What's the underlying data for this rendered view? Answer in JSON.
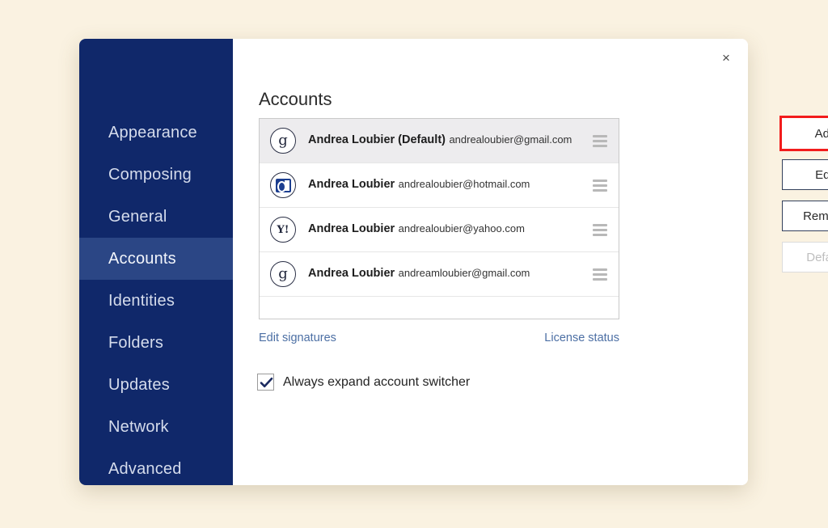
{
  "theme": {
    "page_background": "#FAF2E1",
    "sidebar_background": "#10286A",
    "sidebar_active_background": "#2B4685",
    "accent_highlight": "#F21C1C",
    "link_color": "#4C6FA4",
    "row_selected_background": "#EDECEE"
  },
  "dialog": {
    "close_label": "×"
  },
  "sidebar": {
    "items": [
      {
        "label": "Appearance",
        "active": false
      },
      {
        "label": "Composing",
        "active": false
      },
      {
        "label": "General",
        "active": false
      },
      {
        "label": "Accounts",
        "active": true
      },
      {
        "label": "Identities",
        "active": false
      },
      {
        "label": "Folders",
        "active": false
      },
      {
        "label": "Updates",
        "active": false
      },
      {
        "label": "Network",
        "active": false
      },
      {
        "label": "Advanced",
        "active": false
      }
    ]
  },
  "panel": {
    "title": "Accounts",
    "accounts": [
      {
        "name": "Andrea Loubier (Default)",
        "email": "andrealoubier@gmail.com",
        "provider": "google",
        "provider_glyph": "g",
        "selected": true
      },
      {
        "name": "Andrea Loubier",
        "email": "andrealoubier@hotmail.com",
        "provider": "outlook",
        "provider_glyph": "O",
        "selected": false
      },
      {
        "name": "Andrea Loubier",
        "email": "andrealoubier@yahoo.com",
        "provider": "yahoo",
        "provider_glyph": "Y!",
        "selected": false
      },
      {
        "name": "Andrea Loubier",
        "email": "andreamloubier@gmail.com",
        "provider": "google",
        "provider_glyph": "g",
        "selected": false
      }
    ],
    "buttons": [
      {
        "label": "Add",
        "state": "highlighted"
      },
      {
        "label": "Edit",
        "state": "enabled"
      },
      {
        "label": "Remove",
        "state": "enabled"
      },
      {
        "label": "Default",
        "state": "disabled"
      }
    ],
    "links": {
      "edit_signatures": "Edit signatures",
      "license_status": "License status"
    },
    "switcher": {
      "label": "Always expand account switcher",
      "checked": true
    }
  }
}
